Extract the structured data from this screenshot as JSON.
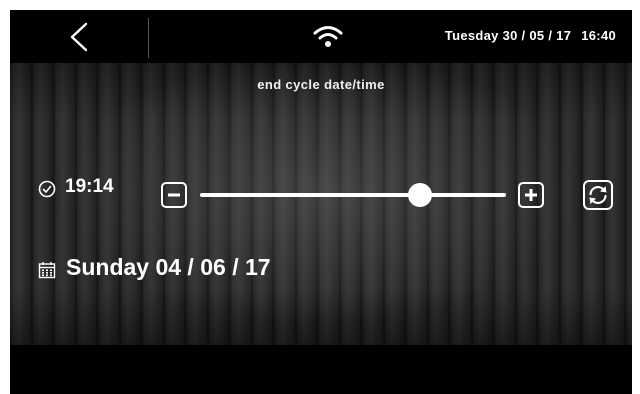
{
  "header": {
    "back_icon": "chevron-left-icon",
    "wifi_icon": "wifi-icon",
    "date": "Tuesday 30 / 05 / 17",
    "time": "16:40"
  },
  "page": {
    "title": "end cycle date/time"
  },
  "end_time": {
    "icon": "clock-icon",
    "value": "19:14"
  },
  "slider": {
    "decrease_icon": "minus-icon",
    "increase_icon": "plus-icon",
    "level_fraction": 0.72
  },
  "sync_icon": "sync-icon",
  "end_date": {
    "icon": "calendar-icon",
    "value": "Sunday 04 / 06 / 17"
  },
  "colors": {
    "background": "#000000",
    "foreground": "#ffffff"
  }
}
